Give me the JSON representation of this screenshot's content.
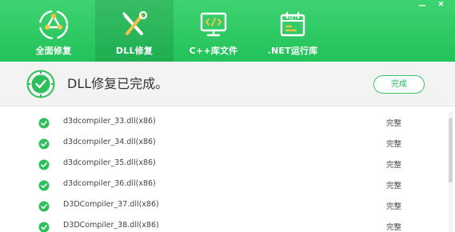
{
  "tabs": [
    {
      "label": "全面修复",
      "icon": "recycle-icon",
      "active": false
    },
    {
      "label": "DLL修复",
      "icon": "tools-icon",
      "active": true
    },
    {
      "label": "C++库文件",
      "icon": "code-monitor-icon",
      "active": false
    },
    {
      "label": ".NET运行库",
      "icon": "net-calendar-icon",
      "active": false
    }
  ],
  "status": {
    "message": "DLL修复已完成。",
    "button_label": "完成"
  },
  "files": [
    {
      "name": "d3dcompiler_33.dll(x86)",
      "state": "完整"
    },
    {
      "name": "d3dcompiler_34.dll(x86)",
      "state": "完整"
    },
    {
      "name": "d3dcompiler_35.dll(x86)",
      "state": "完整"
    },
    {
      "name": "d3dcompiler_36.dll(x86)",
      "state": "完整"
    },
    {
      "name": "D3DCompiler_37.dll(x86)",
      "state": "完整"
    },
    {
      "name": "D3DCompiler_38.dll(x86)",
      "state": "完整"
    }
  ],
  "colors": {
    "brand_green": "#22c25a",
    "check_green": "#2dbf5c",
    "status_bg": "#f2f3f2"
  }
}
